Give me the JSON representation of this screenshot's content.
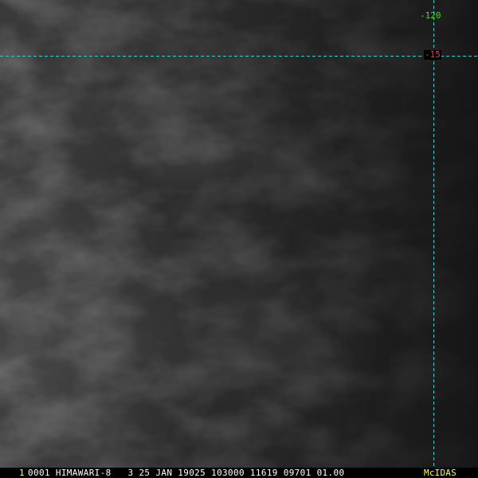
{
  "image": {
    "description_free": true
  },
  "graticule": {
    "longitude_label": "-120",
    "latitude_label": "-15",
    "longitude_color": "#33dd33",
    "latitude_color": "#ff3333",
    "line_color": "#33cccc"
  },
  "status_bar": {
    "frame_number": "1",
    "frame_number_color": "#ffff33",
    "text": "0001 HIMAWARI-8   3 25 JAN 19025 103000 11619 09701 01.00",
    "text_color": "#ffffff",
    "logo": "McIDAS",
    "logo_color": "#ffff33"
  }
}
